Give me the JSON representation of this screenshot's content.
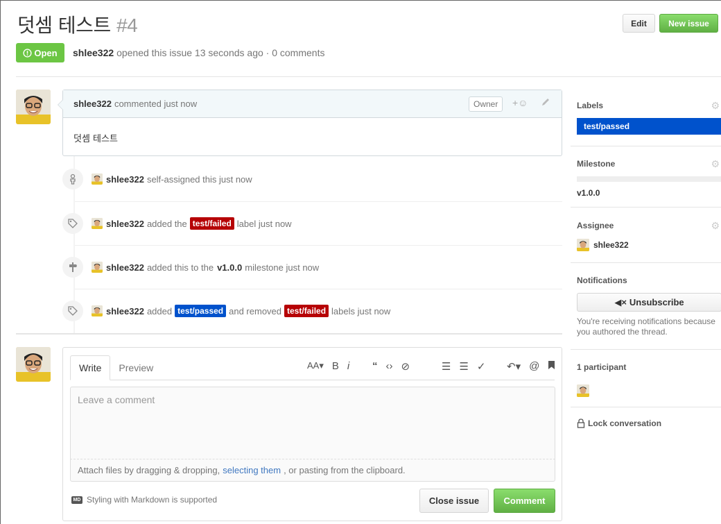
{
  "issue": {
    "title": "덧셈 테스트",
    "number": "#4",
    "state": "Open",
    "author": "shlee322",
    "meta_text": "opened this issue 13 seconds ago · 0 comments"
  },
  "header": {
    "edit_label": "Edit",
    "new_issue_label": "New issue"
  },
  "comment": {
    "author": "shlee322",
    "time_text": "commented just now",
    "owner_badge": "Owner",
    "body": "덧셈 테스트"
  },
  "events": [
    {
      "icon": "person-icon",
      "actor": "shlee322",
      "pre": "self-assigned this just now"
    },
    {
      "icon": "tag-icon",
      "actor": "shlee322",
      "pre": "added the",
      "label": "test/failed",
      "post": "label just now"
    },
    {
      "icon": "milestone-icon",
      "actor": "shlee322",
      "pre": "added this to the",
      "milestone": "v1.0.0",
      "post": "milestone just now"
    },
    {
      "icon": "tag-icon",
      "actor": "shlee322",
      "pre": "added",
      "label_added": "test/passed",
      "mid": "and removed",
      "label_removed": "test/failed",
      "post": "labels just now"
    }
  ],
  "form": {
    "tab_write": "Write",
    "tab_preview": "Preview",
    "placeholder": "Leave a comment",
    "attach_pre": "Attach files by dragging & dropping,",
    "attach_link": "selecting them",
    "attach_post": ", or pasting from the clipboard.",
    "markdown_note": "Styling with Markdown is supported",
    "markdown_badge": "MD",
    "close_label": "Close issue",
    "comment_label": "Comment"
  },
  "sidebar": {
    "labels_title": "Labels",
    "label": "test/passed",
    "milestone_title": "Milestone",
    "milestone": "v1.0.0",
    "assignee_title": "Assignee",
    "assignee": "shlee322",
    "notifications_title": "Notifications",
    "unsubscribe_label": "Unsubscribe",
    "notif_reason": "You're receiving notifications because you authored the thread.",
    "participants_title": "1 participant",
    "lock_label": "Lock conversation"
  },
  "colors": {
    "open_green": "#6cc644",
    "label_red": "#b60205",
    "label_blue": "#0052cc",
    "link_blue": "#4078c0"
  }
}
